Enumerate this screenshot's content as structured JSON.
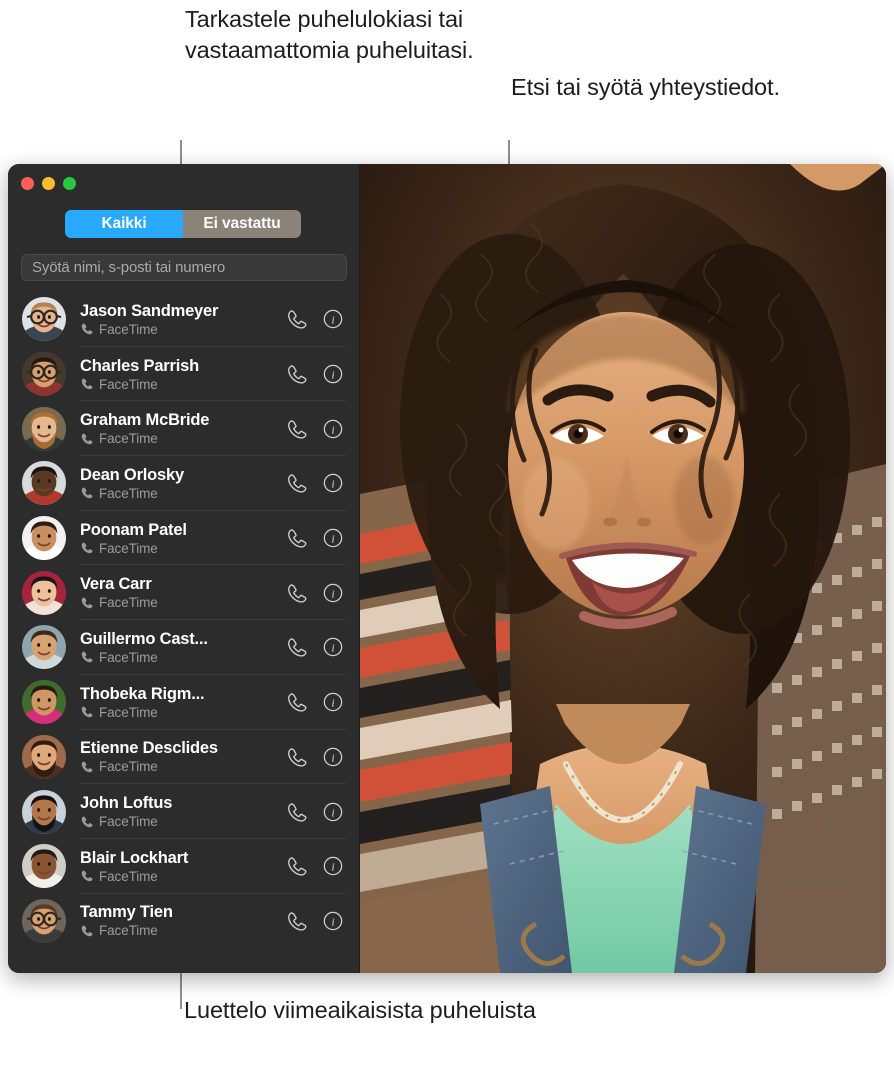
{
  "annotations": {
    "top_left": "Tarkastele puhelulokiasi tai vastaamattomia puheluitasi.",
    "top_right": "Etsi tai syötä yhteystiedot.",
    "bottom": "Luettelo viimeaikaisista puheluista"
  },
  "window": {
    "traffic_lights": {
      "close": "close-button",
      "minimize": "minimize-button",
      "maximize": "maximize-button",
      "close_color": "#ff5f57",
      "minimize_color": "#febc2e",
      "maximize_color": "#28c840"
    },
    "segmented_control": {
      "accent_color": "#27aaff",
      "inactive_color": "#8b8278",
      "options": [
        {
          "label": "Kaikki",
          "selected": true
        },
        {
          "label": "Ei vastattu",
          "selected": false
        }
      ]
    },
    "search": {
      "placeholder": "Syötä nimi, s-posti tai numero",
      "value": ""
    },
    "contacts": [
      {
        "name": "Jason Sandmeyer",
        "service": "FaceTime",
        "avatar_bg": "#dfe2e4",
        "skin": "#e8b48f",
        "hair": "#b38451",
        "glasses": true,
        "beard": false,
        "top": "#3b4452"
      },
      {
        "name": "Charles Parrish",
        "service": "FaceTime",
        "avatar_bg": "#47382c",
        "skin": "#d8a06e",
        "hair": "#231a14",
        "glasses": true,
        "beard": false,
        "top": "#8c3430"
      },
      {
        "name": "Graham McBride",
        "service": "FaceTime",
        "avatar_bg": "#7a6a50",
        "skin": "#e6b892",
        "hair": "#b2702f",
        "glasses": false,
        "beard": true,
        "top": "#2f3a3c"
      },
      {
        "name": "Dean Orlosky",
        "service": "FaceTime",
        "avatar_bg": "#d8dbdd",
        "skin": "#5a3a22",
        "hair": "#1b1310",
        "glasses": false,
        "beard": false,
        "top": "#b03a2e"
      },
      {
        "name": "Poonam Patel",
        "service": "FaceTime",
        "avatar_bg": "#f2f2f2",
        "skin": "#c98f5f",
        "hair": "#2b1d16",
        "glasses": false,
        "beard": false,
        "top": "#ffffff"
      },
      {
        "name": "Vera Carr",
        "service": "FaceTime",
        "avatar_bg": "#a3243c",
        "skin": "#edc19b",
        "hair": "#1d1416",
        "glasses": false,
        "beard": false,
        "top": "#f0e3d8"
      },
      {
        "name": "Guillermo Cast...",
        "service": "FaceTime",
        "avatar_bg": "#8fa4ab",
        "skin": "#d9a271",
        "hair": "#3a2a20",
        "glasses": false,
        "beard": false,
        "top": "#cfd8da"
      },
      {
        "name": "Thobeka Rigm...",
        "service": "FaceTime",
        "avatar_bg": "#3f6b2c",
        "skin": "#cf9764",
        "hair": "#251a14",
        "glasses": false,
        "beard": false,
        "top": "#d62e7a"
      },
      {
        "name": "Etienne Desclides",
        "service": "FaceTime",
        "avatar_bg": "#9e6a4a",
        "skin": "#dfa87a",
        "hair": "#2c1d15",
        "glasses": false,
        "beard": true,
        "top": "#4d2f22"
      },
      {
        "name": "John Loftus",
        "service": "FaceTime",
        "avatar_bg": "#c8d2d8",
        "skin": "#b4774a",
        "hair": "#140f0d",
        "glasses": false,
        "beard": true,
        "top": "#2c3a4a"
      },
      {
        "name": "Blair Lockhart",
        "service": "FaceTime",
        "avatar_bg": "#cfcfc7",
        "skin": "#8a5632",
        "hair": "#231a17",
        "glasses": false,
        "beard": false,
        "top": "#f2efe9"
      },
      {
        "name": "Tammy Tien",
        "service": "FaceTime",
        "avatar_bg": "#6e655c",
        "skin": "#d8a371",
        "hair": "#5a3b23",
        "glasses": true,
        "beard": false,
        "top": "#3b3b3b"
      }
    ],
    "row_actions": {
      "call": "phone-icon",
      "info": "info-icon"
    },
    "video": {
      "description": "FaceTime video call preview"
    }
  }
}
